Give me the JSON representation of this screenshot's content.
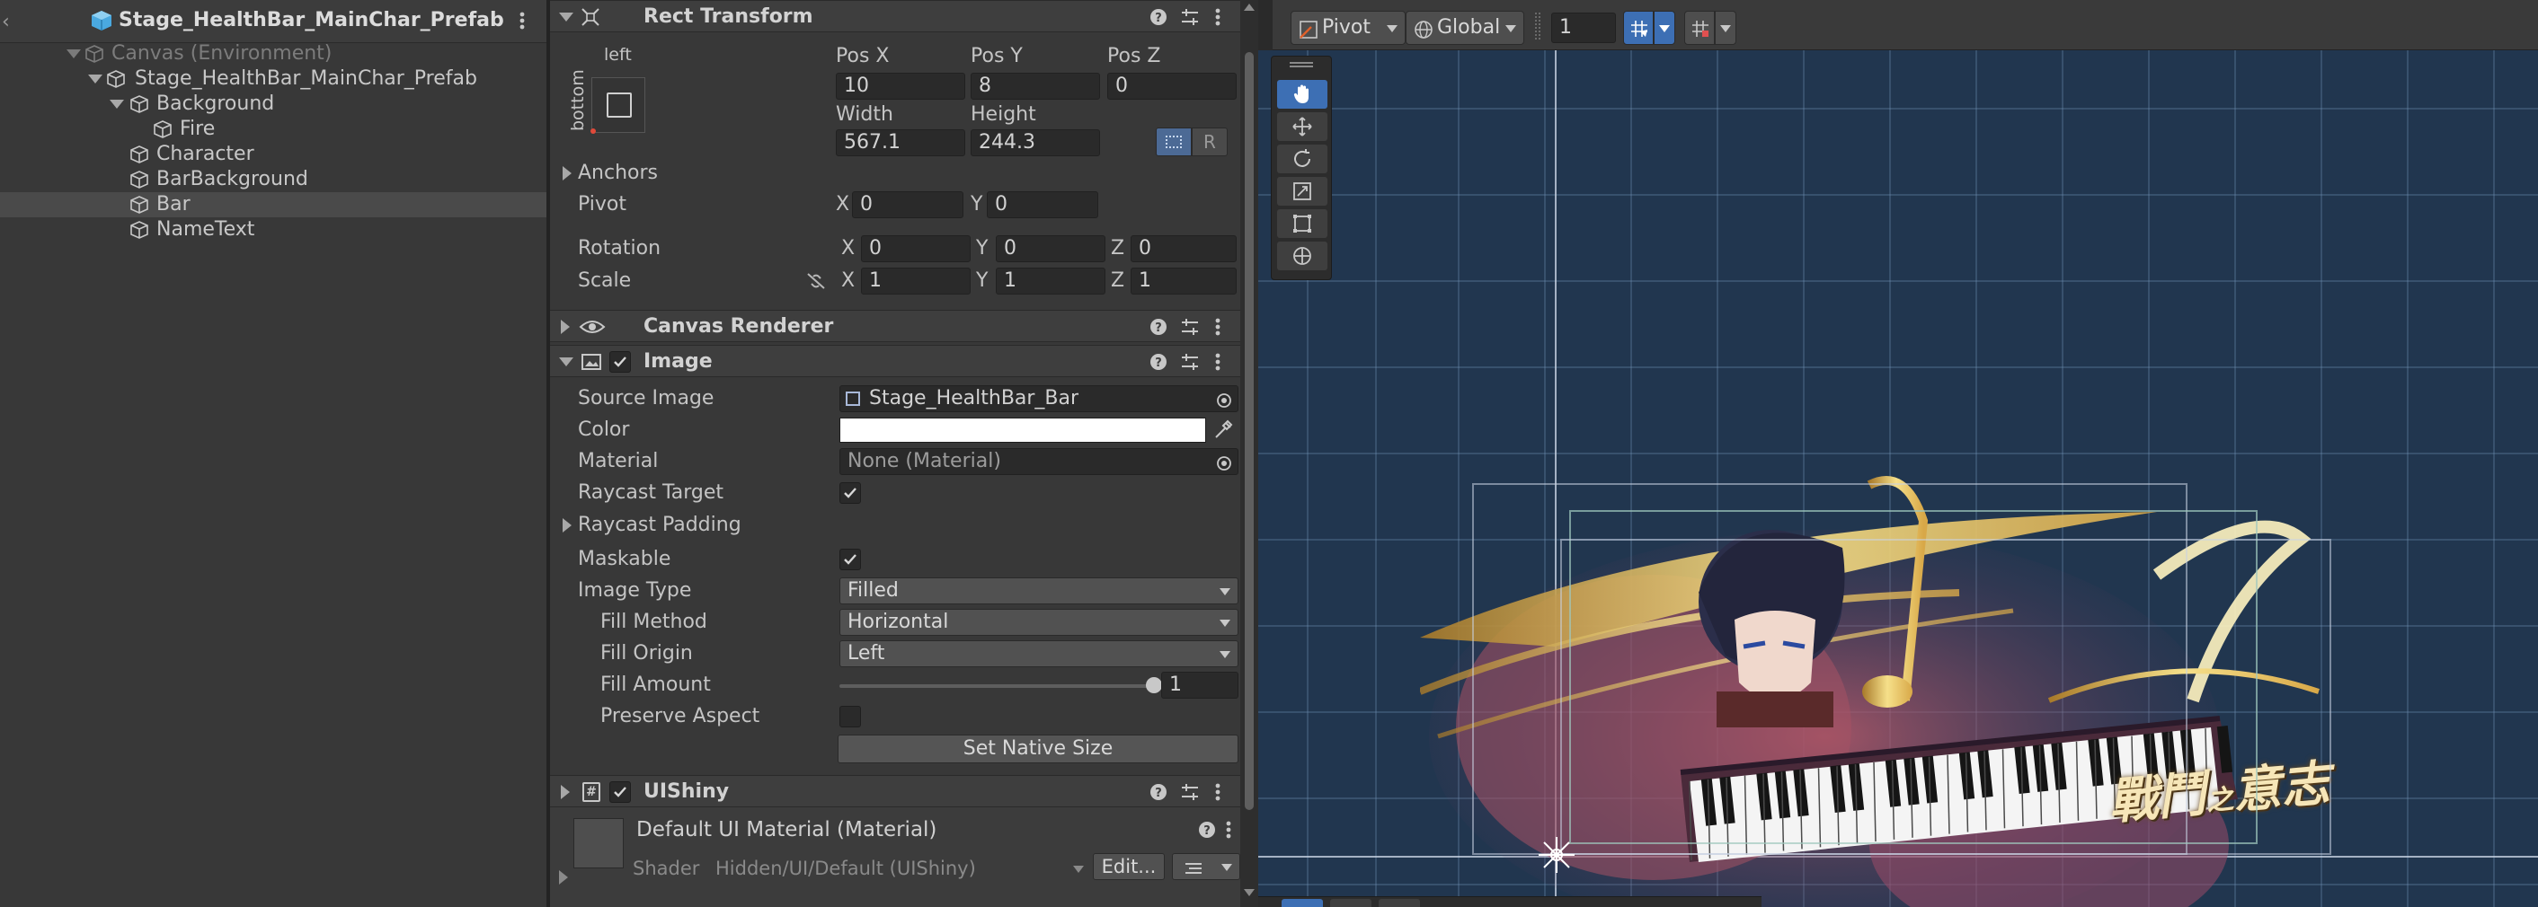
{
  "hierarchy": {
    "header_title": "Stage_HealthBar_MainChar_Prefab",
    "items": [
      {
        "label": "Canvas (Environment)"
      },
      {
        "label": "Stage_HealthBar_MainChar_Prefab"
      },
      {
        "label": "Background"
      },
      {
        "label": "Fire"
      },
      {
        "label": "Character"
      },
      {
        "label": "BarBackground"
      },
      {
        "label": "Bar"
      },
      {
        "label": "NameText"
      }
    ]
  },
  "rect_transform": {
    "title": "Rect Transform",
    "anchor_preset_top": "left",
    "anchor_preset_side": "bottom",
    "pos_x_label": "Pos X",
    "pos_x": "10",
    "pos_y_label": "Pos Y",
    "pos_y": "8",
    "pos_z_label": "Pos Z",
    "pos_z": "0",
    "width_label": "Width",
    "width": "567.1",
    "height_label": "Height",
    "height": "244.3",
    "r_label": "R",
    "anchors_label": "Anchors",
    "pivot_label": "Pivot",
    "pivot_x_label": "X",
    "pivot_x": "0",
    "pivot_y_label": "Y",
    "pivot_y": "0",
    "rotation_label": "Rotation",
    "rot_x_label": "X",
    "rot_x": "0",
    "rot_y_label": "Y",
    "rot_y": "0",
    "rot_z_label": "Z",
    "rot_z": "0",
    "scale_label": "Scale",
    "scale_x_label": "X",
    "scale_x": "1",
    "scale_y_label": "Y",
    "scale_y": "1",
    "scale_z_label": "Z",
    "scale_z": "1"
  },
  "canvas_renderer": {
    "title": "Canvas Renderer"
  },
  "image": {
    "title": "Image",
    "source_image_label": "Source Image",
    "source_image": "Stage_HealthBar_Bar",
    "color_label": "Color",
    "color_value": "#ffffff",
    "material_label": "Material",
    "material": "None (Material)",
    "raycast_target_label": "Raycast Target",
    "raycast_padding_label": "Raycast Padding",
    "maskable_label": "Maskable",
    "image_type_label": "Image Type",
    "image_type": "Filled",
    "fill_method_label": "Fill Method",
    "fill_method": "Horizontal",
    "fill_origin_label": "Fill Origin",
    "fill_origin": "Left",
    "fill_amount_label": "Fill Amount",
    "fill_amount": "1",
    "preserve_aspect_label": "Preserve Aspect",
    "set_native_size": "Set Native Size"
  },
  "uishiny": {
    "title": "UIShiny"
  },
  "material_section": {
    "title": "Default UI Material (Material)",
    "shader_label": "Shader",
    "shader": "Hidden/UI/Default (UIShiny)",
    "edit_button": "Edit..."
  },
  "scene_toolbar": {
    "pivot": "Pivot",
    "global": "Global",
    "grid_size": "1"
  },
  "scene": {
    "banner_text_big": "戰鬥",
    "banner_text_small": "之",
    "banner_text_big2": "意志"
  },
  "colors": {
    "accent": "#3d6fb4",
    "scene_bg": "#21364f",
    "panel_bg": "#383838"
  }
}
